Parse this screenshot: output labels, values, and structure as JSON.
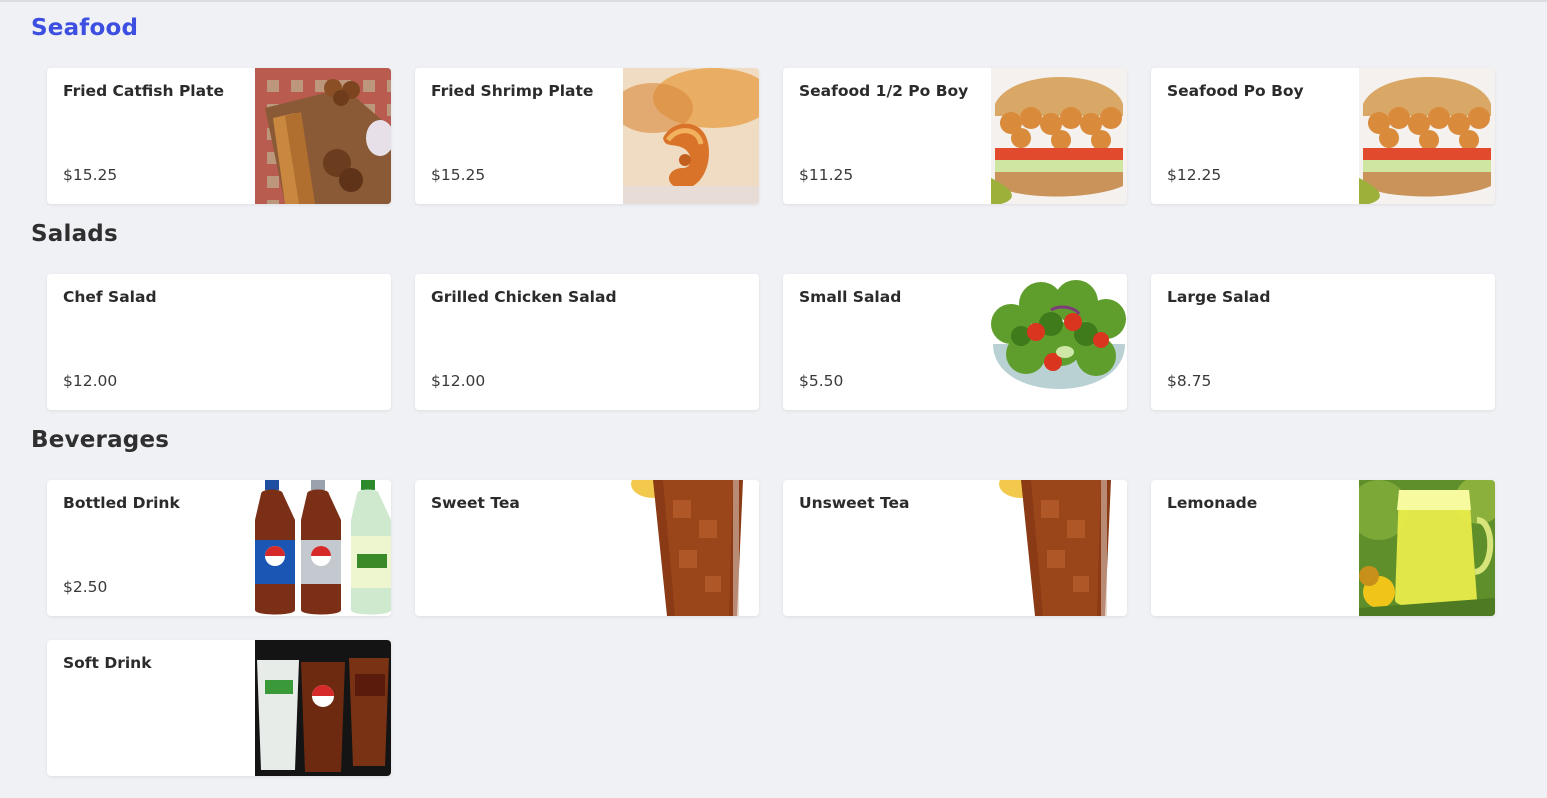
{
  "sections": [
    {
      "title": "Seafood",
      "items": [
        {
          "name": "Fried Catfish Plate",
          "price": "$15.25",
          "image": "catfish-photo"
        },
        {
          "name": "Fried Shrimp Plate",
          "price": "$15.25",
          "image": "shrimp-photo"
        },
        {
          "name": "Seafood 1/2 Po Boy",
          "price": "$11.25",
          "image": "po-boy-photo"
        },
        {
          "name": "Seafood Po Boy",
          "price": "$12.25",
          "image": "po-boy-photo"
        }
      ]
    },
    {
      "title": "Salads",
      "items": [
        {
          "name": "Chef Salad",
          "price": "$12.00"
        },
        {
          "name": "Grilled Chicken Salad",
          "price": "$12.00"
        },
        {
          "name": "Small Salad",
          "price": "$5.50",
          "image": "salad-photo"
        },
        {
          "name": "Large Salad",
          "price": "$8.75"
        }
      ]
    },
    {
      "title": "Beverages",
      "items": [
        {
          "name": "Bottled Drink",
          "price": "$2.50",
          "image": "bottles-photo"
        },
        {
          "name": "Sweet Tea",
          "price": "",
          "image": "iced-tea-photo"
        },
        {
          "name": "Unsweet Tea",
          "price": "",
          "image": "iced-tea-photo"
        },
        {
          "name": "Lemonade",
          "price": "",
          "image": "lemonade-photo"
        },
        {
          "name": "Soft Drink",
          "price": "",
          "image": "soft-drinks-photo"
        }
      ]
    }
  ],
  "colors": {
    "background": "#f0f1f5",
    "active_section": "#3d4fe0",
    "card": "#ffffff"
  }
}
